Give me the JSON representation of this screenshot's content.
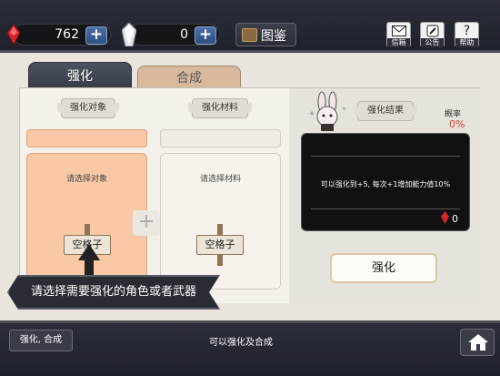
{
  "topbar": {
    "red_gem_amount": "762",
    "white_gem_amount": "0",
    "codex_label": "图鉴",
    "mail_label": "信箱",
    "notice_label": "公告",
    "help_label": "帮助",
    "help_glyph": "?"
  },
  "tabs": {
    "enhance": "强化",
    "combine": "合成"
  },
  "left_panel": {
    "target_header": "强化对象",
    "target_hint": "请选择对象",
    "target_slot_label": "空格子",
    "material_header": "强化材料",
    "material_hint": "请选择材料",
    "material_slot_label": "空格子",
    "plus_symbol": "+"
  },
  "right_panel": {
    "result_header": "强化结果",
    "rate_label": "概率",
    "rate_value": "0%",
    "result_text": "可以强化到+5, 每次+1增加能力值10%",
    "cost_value": "0",
    "enhance_button": "强化"
  },
  "tooltip": {
    "text": "请选择需要强化的角色或者武器"
  },
  "bottombar": {
    "mode_button": "强化, 合成",
    "status_text": "可以强化及合成"
  },
  "colors": {
    "accent_red": "#e03a2e",
    "peach": "#f9c8a6",
    "topbar_bg": "#2b2e38"
  }
}
